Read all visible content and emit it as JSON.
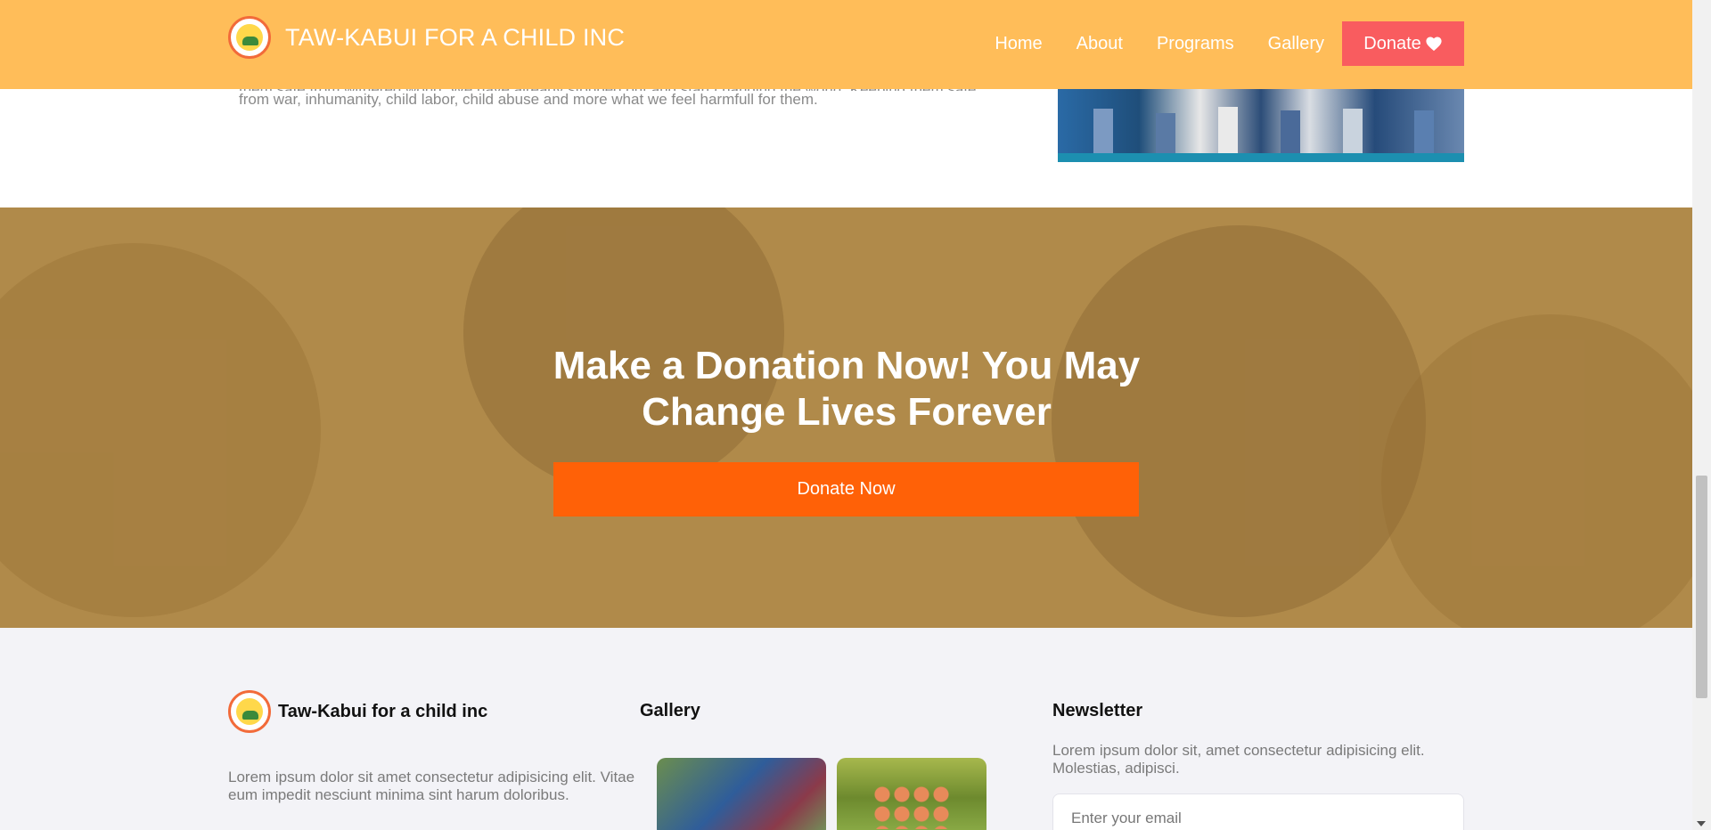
{
  "header": {
    "brand_title": "TAW-KABUI FOR A CHILD INC",
    "nav": [
      "Home",
      "About",
      "Programs",
      "Gallery"
    ],
    "donate_label": "Donate"
  },
  "intro": {
    "line1": "them safe from withered world. We have already stopped out and start changing the world. Keeping them safe",
    "line2": "from war, inhumanity, child labor, child abuse and more what we feel harmfull for them."
  },
  "hero": {
    "title": "Make a Donation Now! You May Change Lives Forever",
    "button": "Donate Now"
  },
  "footer": {
    "brand_title": "Taw-Kabui for a child inc",
    "description": "Lorem ipsum dolor sit amet consectetur adipisicing elit. Vitae eum impedit nesciunt minima sint harum doloribus.",
    "gallery_title": "Gallery",
    "newsletter_title": "Newsletter",
    "newsletter_desc": "Lorem ipsum dolor sit, amet consectetur adipisicing elit. Molestias, adipisci.",
    "email_placeholder": "Enter your email"
  },
  "colors": {
    "header_bg": "#ffbd59",
    "donate_btn": "#f95c5f",
    "hero_btn": "#ff6107",
    "hero_overlay": "#b08a4a"
  }
}
